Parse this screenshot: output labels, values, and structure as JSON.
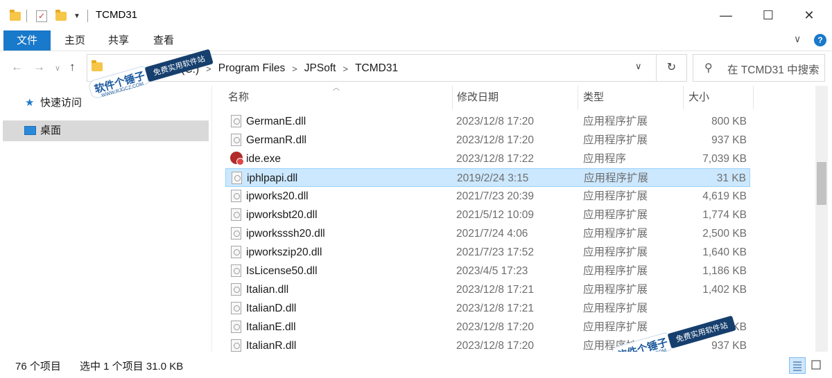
{
  "titlebar": {
    "title": "TCMD31",
    "minimize": "—",
    "maximize": "☐",
    "close": "✕"
  },
  "ribbon": {
    "tabs": [
      "文件",
      "主页",
      "共享",
      "查看"
    ],
    "expand_glyph": "∨",
    "help_glyph": "?"
  },
  "nav": {
    "back": "←",
    "forward": "→",
    "recent": "∨",
    "up": "↑"
  },
  "address": {
    "breadcrumbs": [
      "磁盘 (C:)",
      "Program Files",
      "JPSoft",
      "TCMD31"
    ],
    "separator": ">",
    "dropdown_glyph": "∨",
    "refresh_glyph": "↻"
  },
  "search": {
    "placeholder": "在 TCMD31 中搜索",
    "icon": "search-icon"
  },
  "navpane": {
    "items": [
      {
        "label": "快速访问",
        "icon": "star-icon"
      },
      {
        "label": "桌面",
        "icon": "desktop-icon"
      }
    ]
  },
  "columns": {
    "name": "名称",
    "date": "修改日期",
    "type": "类型",
    "size": "大小"
  },
  "files": [
    {
      "name": "GermanE.dll",
      "date": "2023/12/8 17:20",
      "type": "应用程序扩展",
      "size": "800 KB",
      "icon": "dll-icon"
    },
    {
      "name": "GermanR.dll",
      "date": "2023/12/8 17:20",
      "type": "应用程序扩展",
      "size": "937 KB",
      "icon": "dll-icon"
    },
    {
      "name": "ide.exe",
      "date": "2023/12/8 17:22",
      "type": "应用程序",
      "size": "7,039 KB",
      "icon": "exe-icon"
    },
    {
      "name": "iphlpapi.dll",
      "date": "2019/2/24 3:15",
      "type": "应用程序扩展",
      "size": "31 KB",
      "icon": "dll-icon",
      "selected": true
    },
    {
      "name": "ipworks20.dll",
      "date": "2021/7/23 20:39",
      "type": "应用程序扩展",
      "size": "4,619 KB",
      "icon": "dll-icon"
    },
    {
      "name": "ipworksbt20.dll",
      "date": "2021/5/12 10:09",
      "type": "应用程序扩展",
      "size": "1,774 KB",
      "icon": "dll-icon"
    },
    {
      "name": "ipworksssh20.dll",
      "date": "2021/7/24 4:06",
      "type": "应用程序扩展",
      "size": "2,500 KB",
      "icon": "dll-icon"
    },
    {
      "name": "ipworkszip20.dll",
      "date": "2021/7/23 17:52",
      "type": "应用程序扩展",
      "size": "1,640 KB",
      "icon": "dll-icon"
    },
    {
      "name": "IsLicense50.dll",
      "date": "2023/4/5 17:23",
      "type": "应用程序扩展",
      "size": "1,186 KB",
      "icon": "dll-icon"
    },
    {
      "name": "Italian.dll",
      "date": "2023/12/8 17:21",
      "type": "应用程序扩展",
      "size": "1,402 KB",
      "icon": "dll-icon"
    },
    {
      "name": "ItalianD.dll",
      "date": "2023/12/8 17:21",
      "type": "应用程序扩展",
      "size": "",
      "icon": "dll-icon"
    },
    {
      "name": "ItalianE.dll",
      "date": "2023/12/8 17:20",
      "type": "应用程序扩展",
      "size": "800 KB",
      "icon": "dll-icon"
    },
    {
      "name": "ItalianR.dll",
      "date": "2023/12/8 17:20",
      "type": "应用程序扩展",
      "size": "937 KB",
      "icon": "dll-icon"
    }
  ],
  "status": {
    "count": "76 个项目",
    "selection": "选中 1 个项目  31.0 KB"
  },
  "watermark": {
    "logo": "软件个锤子",
    "tag": "免费实用软件站",
    "site": "WWW.RJGCZ.COM"
  },
  "colors": {
    "accent": "#1979ca",
    "selection": "#cce8ff",
    "selection_border": "#99d1ff"
  }
}
